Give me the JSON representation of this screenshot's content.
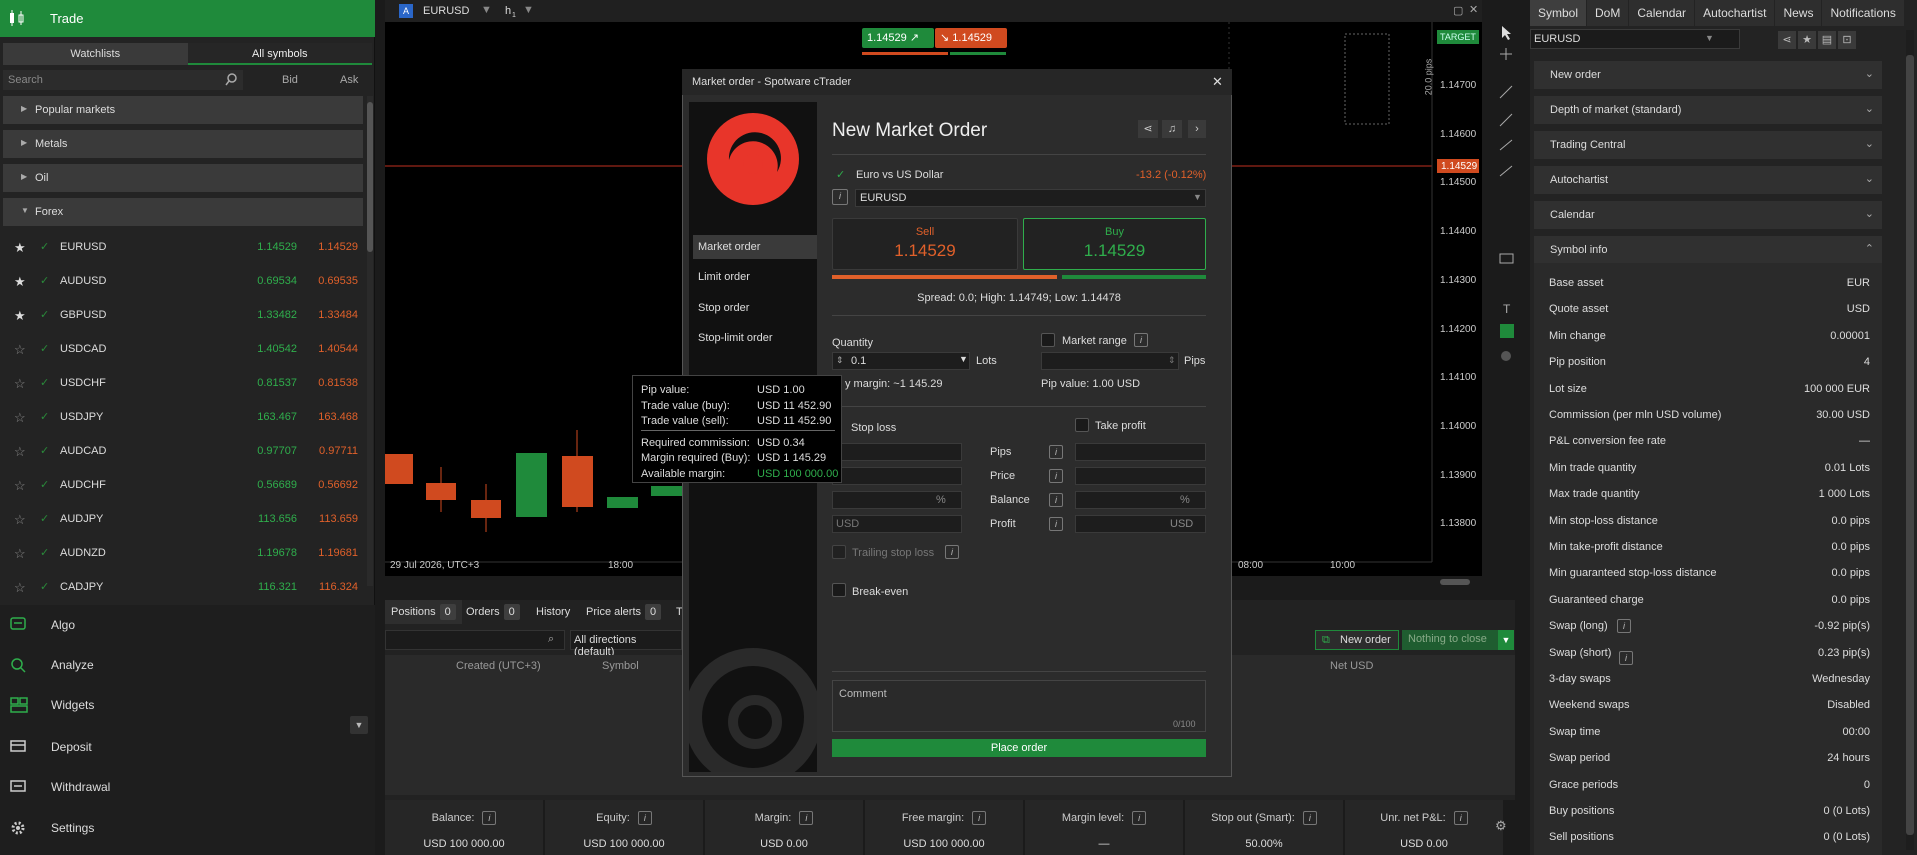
{
  "colors": {
    "green": "#1f8a3b",
    "sell": "#e0602a",
    "buy": "#2fae4c"
  },
  "left": {
    "header": "Trade",
    "tabs": [
      "Watchlists",
      "All symbols"
    ],
    "search_placeholder": "Search",
    "bid_col": "Bid",
    "ask_col": "Ask",
    "categories": [
      "Popular markets",
      "Metals",
      "Oil",
      "Forex"
    ],
    "symbols": [
      {
        "name": "EURUSD",
        "bid": "1.14529",
        "ask": "1.14529",
        "fav": true
      },
      {
        "name": "AUDUSD",
        "bid": "0.69534",
        "ask": "0.69535",
        "fav": true
      },
      {
        "name": "GBPUSD",
        "bid": "1.33482",
        "ask": "1.33484",
        "fav": true
      },
      {
        "name": "USDCAD",
        "bid": "1.40542",
        "ask": "1.40544",
        "fav": false
      },
      {
        "name": "USDCHF",
        "bid": "0.81537",
        "ask": "0.81538",
        "fav": false
      },
      {
        "name": "USDJPY",
        "bid": "163.467",
        "ask": "163.468",
        "fav": false
      },
      {
        "name": "AUDCAD",
        "bid": "0.97707",
        "ask": "0.97711",
        "fav": false
      },
      {
        "name": "AUDCHF",
        "bid": "0.56689",
        "ask": "0.56692",
        "fav": false
      },
      {
        "name": "AUDJPY",
        "bid": "113.656",
        "ask": "113.659",
        "fav": false
      },
      {
        "name": "AUDNZD",
        "bid": "1.19678",
        "ask": "1.19681",
        "fav": false
      },
      {
        "name": "CADJPY",
        "bid": "116.321",
        "ask": "116.324",
        "fav": false
      }
    ],
    "nav": [
      "Algo",
      "Analyze",
      "Widgets",
      "Deposit",
      "Withdrawal",
      "Settings"
    ]
  },
  "chart": {
    "symbol": "EURUSD",
    "timeframe": "h",
    "timeframe_sub": "1",
    "sell_btn": "1.14529",
    "buy_btn": "1.14529",
    "target_label": "TARGET",
    "pips_label": "20.0 pips",
    "price_ticks": [
      "1.14700",
      "1.14600",
      "1.14500",
      "1.14400",
      "1.14300",
      "1.14200",
      "1.14100",
      "1.14000",
      "1.13900",
      "1.13800"
    ],
    "current_price": "1.14529",
    "time_labels": [
      "29 Jul 2026, UTC+3",
      "18:00",
      "08:00",
      "10:00"
    ]
  },
  "right": {
    "tabs": [
      "Symbol",
      "DoM",
      "Calendar",
      "Autochartist",
      "News",
      "Notifications"
    ],
    "symbol": "EURUSD",
    "sections": [
      "New order",
      "Depth of market (standard)",
      "Trading Central",
      "Autochartist",
      "Calendar",
      "Symbol info"
    ],
    "info": [
      [
        "Base asset",
        "EUR"
      ],
      [
        "Quote asset",
        "USD"
      ],
      [
        "Min change",
        "0.00001"
      ],
      [
        "Pip position",
        "4"
      ],
      [
        "Lot size",
        "100 000 EUR"
      ],
      [
        "Commission (per mln USD volume)",
        "30.00 USD"
      ],
      [
        "P&L conversion fee rate",
        "—"
      ],
      [
        "Min trade quantity",
        "0.01 Lots"
      ],
      [
        "Max trade quantity",
        "1 000 Lots"
      ],
      [
        "Min stop-loss distance",
        "0.0 pips"
      ],
      [
        "Min take-profit distance",
        "0.0 pips"
      ],
      [
        "Min guaranteed stop-loss distance",
        "0.0 pips"
      ],
      [
        "Guaranteed charge",
        "0.0 pips"
      ],
      [
        "Swap (long)",
        "-0.92 pip(s)"
      ],
      [
        "Swap (short)",
        "0.23 pip(s)"
      ],
      [
        "3-day swaps",
        "Wednesday"
      ],
      [
        "Weekend swaps",
        "Disabled"
      ],
      [
        "Swap time",
        "00:00"
      ],
      [
        "Swap period",
        "24 hours"
      ],
      [
        "Grace periods",
        "0"
      ],
      [
        "Buy positions",
        "0  (0 Lots)"
      ],
      [
        "Sell positions",
        "0  (0 Lots)"
      ]
    ]
  },
  "bottom": {
    "tabs": [
      {
        "label": "Positions",
        "count": "0"
      },
      {
        "label": "Orders",
        "count": "0"
      },
      {
        "label": "History"
      },
      {
        "label": "Price alerts",
        "count": "0"
      },
      {
        "label": "T"
      }
    ],
    "filter": "All directions (default)",
    "new_order": "New order",
    "nothing_close": "Nothing to close",
    "cols": [
      "Created (UTC+3)",
      "Symbol",
      "Net USD"
    ],
    "kpis": [
      {
        "k": "Balance:",
        "v": "USD 100 000.00"
      },
      {
        "k": "Equity:",
        "v": "USD 100 000.00"
      },
      {
        "k": "Margin:",
        "v": "USD 0.00"
      },
      {
        "k": "Free margin:",
        "v": "USD 100 000.00"
      },
      {
        "k": "Margin level:",
        "v": "—"
      },
      {
        "k": "Stop out (Smart):",
        "v": "50.00%"
      },
      {
        "k": "Unr. net P&L:",
        "v": "USD 0.00"
      }
    ]
  },
  "dialog": {
    "title": "Market order - Spotware cTrader",
    "heading": "New Market Order",
    "menu": [
      "Market order",
      "Limit order",
      "Stop order",
      "Stop-limit order"
    ],
    "instrument": "Euro vs US Dollar",
    "change": "-13.2 (-0.12%)",
    "symbol": "EURUSD",
    "sell_label": "Sell",
    "sell_price": "1.14529",
    "buy_label": "Buy",
    "buy_price": "1.14529",
    "spread": "Spread: 0.0; High: 1.14749; Low: 1.14478",
    "quantity_label": "Quantity",
    "quantity": "0.1",
    "lots": "Lots",
    "margin_text": "y margin: ~1 145.29",
    "market_range": "Market range",
    "pips": "Pips",
    "pip_value": "Pip value: 1.00 USD",
    "stop_loss": "Stop loss",
    "take_profit": "Take profit",
    "sl_rows": [
      "Pips",
      "Price",
      "Balance",
      "Profit"
    ],
    "pct": "%",
    "usd": "USD",
    "usd_ph": "USD",
    "trailing": "Trailing stop loss",
    "breakeven": "Break-even",
    "comment_ph": "Comment",
    "comment_count": "0/100",
    "place": "Place order"
  },
  "tooltip": [
    [
      "Pip value:",
      "USD 1.00"
    ],
    [
      "Trade value (buy):",
      "USD 11 452.90"
    ],
    [
      "Trade value (sell):",
      "USD 11 452.90"
    ],
    [
      "Required commission:",
      "USD 0.34"
    ],
    [
      "Margin required (Buy):",
      "USD 1 145.29"
    ],
    [
      "Available margin:",
      "USD 100 000.00"
    ]
  ]
}
